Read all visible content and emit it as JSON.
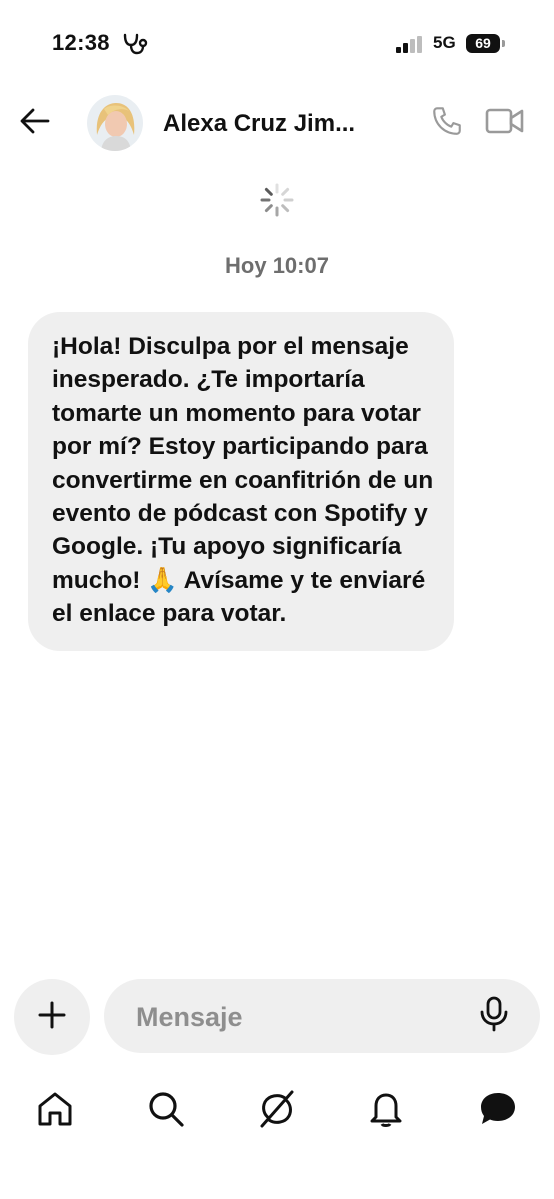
{
  "status_bar": {
    "time": "12:38",
    "network": "5G",
    "battery": "69",
    "app_icon": "stethoscope-icon"
  },
  "header": {
    "contact_name": "Alexa Cruz Jim...",
    "icons": [
      "arrow-left-icon",
      "avatar",
      "phone-icon",
      "video-camera-icon"
    ]
  },
  "chat": {
    "timestamp": "Hoy 10:07",
    "messages": [
      {
        "text": "¡Hola! Disculpa por el mensaje inesperado. ¿Te importaría tomarte un momento para votar por mí? Estoy participando para convertirme en coanfitrión de un evento de pódcast con Spotify y Google. ¡Tu apoyo significaría mucho! 🙏 Avísame y te enviaré el enlace para votar."
      }
    ]
  },
  "composer": {
    "placeholder": "Mensaje",
    "value": "",
    "icons": [
      "plus-icon",
      "microphone-icon"
    ]
  },
  "bottom_nav": {
    "items": [
      "home-icon",
      "search-icon",
      "grok-icon",
      "bell-icon",
      "messages-icon"
    ]
  },
  "colors": {
    "background": "#ffffff",
    "bubble": "#efefef",
    "text": "#111111",
    "muted": "#6e6e6e",
    "placeholder": "#8e8e8e"
  }
}
